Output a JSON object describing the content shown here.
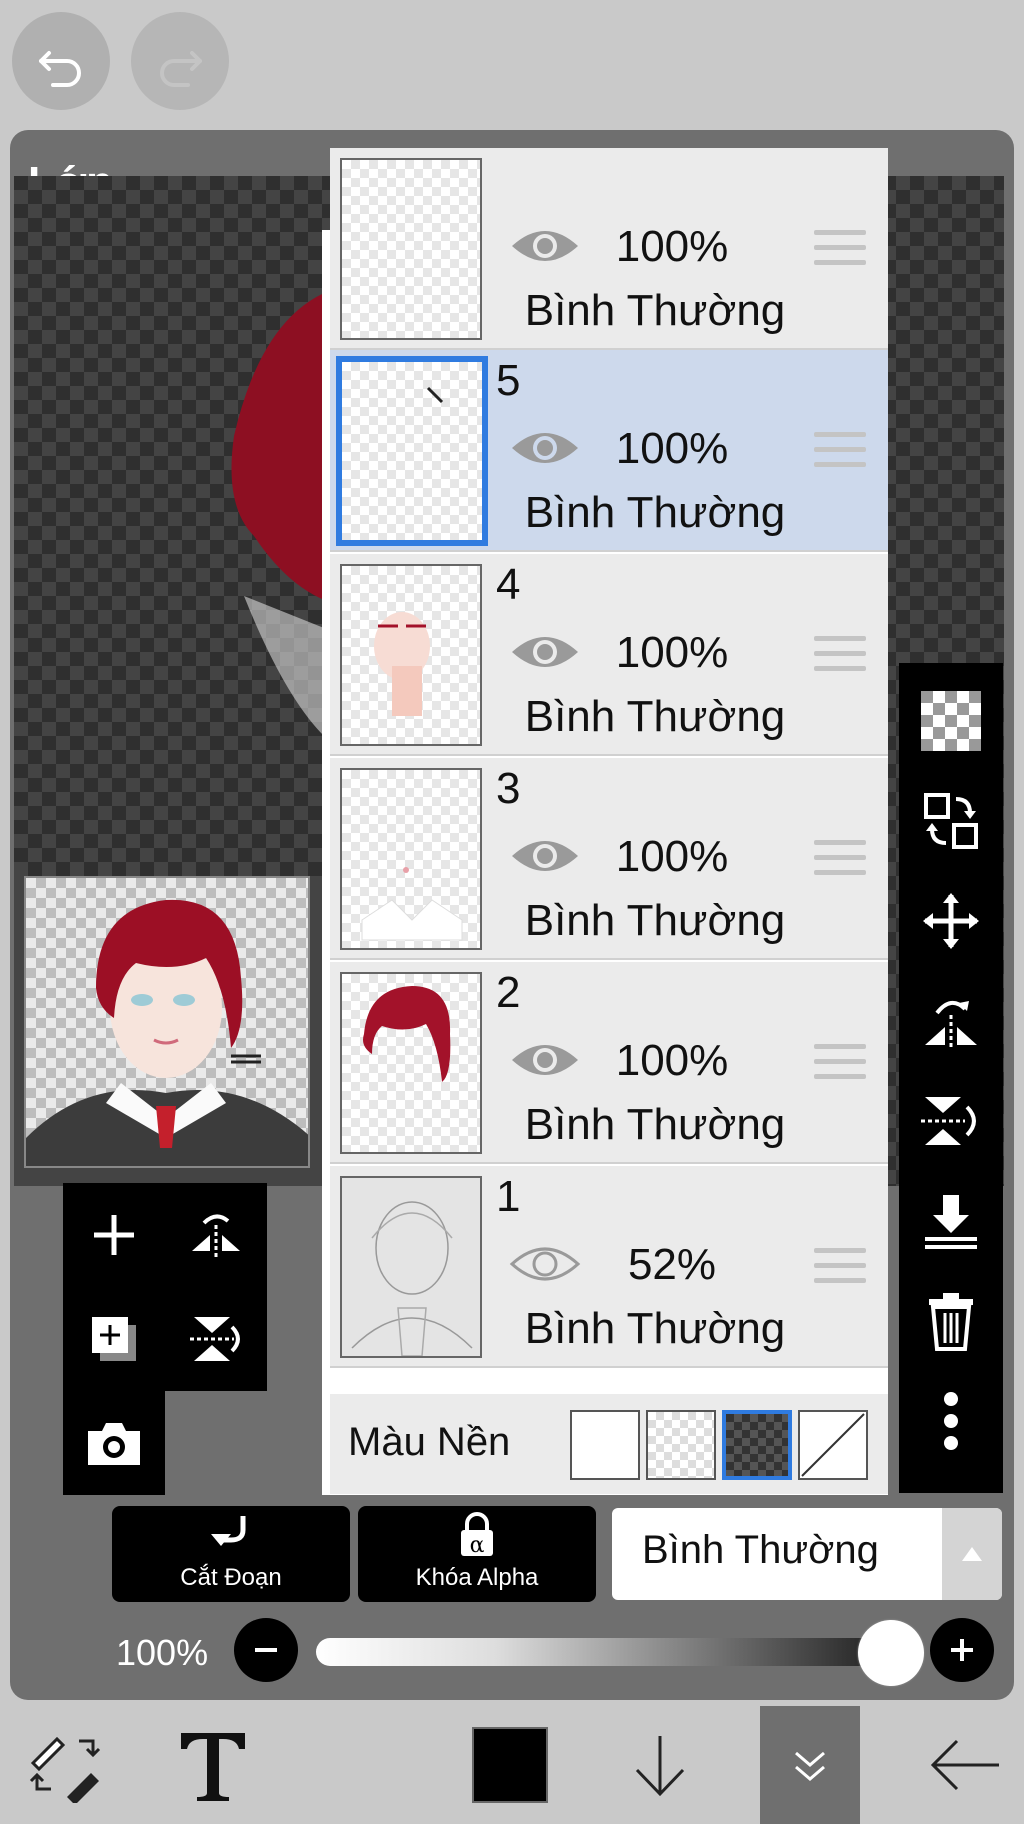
{
  "header": {
    "undo_icon": "undo-icon",
    "redo_icon": "redo-icon"
  },
  "panel": {
    "title": "Lớp"
  },
  "layers": [
    {
      "number": "",
      "opacity": "100%",
      "blend": "Bình Thường",
      "visible": true,
      "selected": false
    },
    {
      "number": "5",
      "opacity": "100%",
      "blend": "Bình Thường",
      "visible": true,
      "selected": true
    },
    {
      "number": "4",
      "opacity": "100%",
      "blend": "Bình Thường",
      "visible": true,
      "selected": false
    },
    {
      "number": "3",
      "opacity": "100%",
      "blend": "Bình Thường",
      "visible": true,
      "selected": false
    },
    {
      "number": "2",
      "opacity": "100%",
      "blend": "Bình Thường",
      "visible": true,
      "selected": false
    },
    {
      "number": "1",
      "opacity": "52%",
      "blend": "Bình Thường",
      "visible": false,
      "selected": false
    }
  ],
  "background": {
    "label": "Màu Nền",
    "options": [
      "white",
      "transparent",
      "dark-checker",
      "none"
    ],
    "selected_index": 2
  },
  "right_tools": [
    "checker-icon",
    "swap-layers-icon",
    "move-icon",
    "flip-horizontal-icon",
    "flip-vertical-icon",
    "merge-down-icon",
    "trash-icon",
    "more-icon"
  ],
  "left_tools": [
    "add-layer-icon",
    "flip-icon",
    "add-layer-copy-icon",
    "flip-vertical-icon",
    "camera-icon"
  ],
  "actions": {
    "clip_label": "Cắt Đoạn",
    "alpha_lock_label": "Khóa Alpha"
  },
  "blend_mode": {
    "value": "Bình Thường"
  },
  "opacity": {
    "label": "100%",
    "value": 1.0
  },
  "bottom_tools": [
    "brush-eraser-switch-icon",
    "text-icon",
    "color-swatch",
    "down-arrow-icon",
    "collapse-icon",
    "back-arrow-icon"
  ],
  "colors": {
    "accent": "#2f7be0",
    "selected_row": "#cdd9ec",
    "hair": "#9c0f25",
    "current_color": "#000000"
  }
}
